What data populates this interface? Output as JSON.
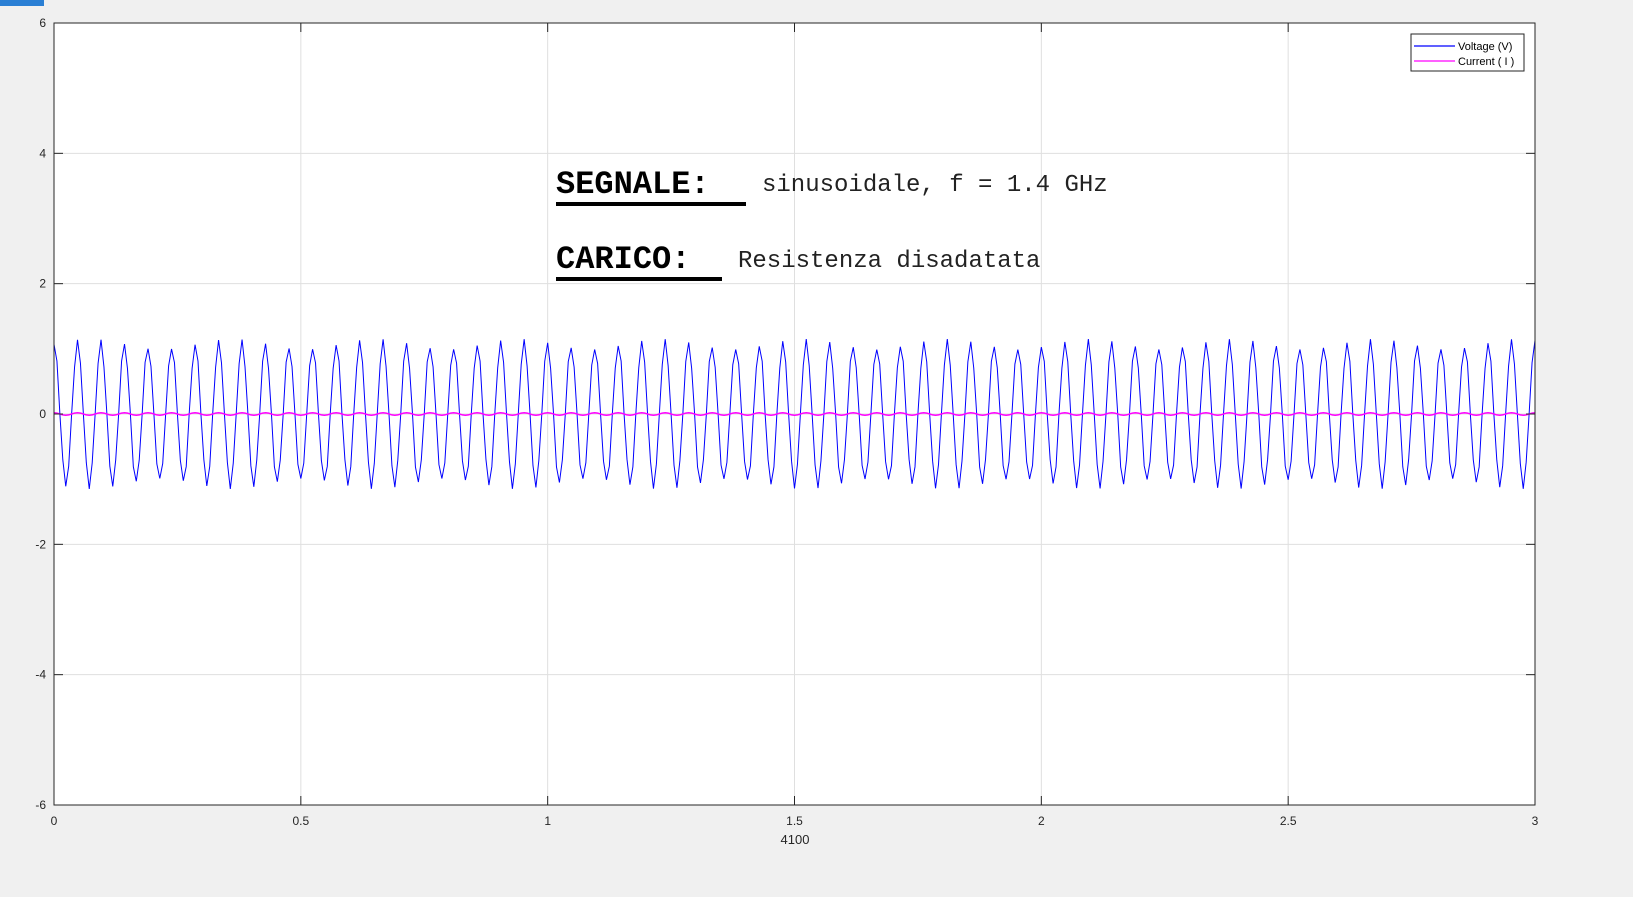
{
  "annotation": {
    "line1_head": "SEGNALE:",
    "line1_body": "sinusoidale, f = 1.4 GHz",
    "line2_head": "CARICO:",
    "line2_body": "Resistenza disadatata"
  },
  "colors": {
    "voltage": "#0000ff",
    "current": "#ff00ff",
    "grid": "#dfdfdf",
    "axes_bg": "#ffffff",
    "window_bg": "#f0f0f0",
    "corner_tab": "#2a7fd4"
  },
  "chart_data": {
    "type": "line",
    "title": "",
    "xlabel": "4100",
    "ylabel": "",
    "xlim": [
      0,
      3
    ],
    "ylim": [
      -6,
      6
    ],
    "xticks": [
      0,
      0.5,
      1,
      1.5,
      2,
      2.5,
      3
    ],
    "xtick_labels": [
      "0",
      "0.5",
      "1",
      "1.5",
      "2",
      "2.5",
      "3"
    ],
    "yticks": [
      -6,
      -4,
      -2,
      0,
      2,
      4,
      6
    ],
    "ytick_labels": [
      "-6",
      "-4",
      "-2",
      "0",
      "2",
      "4",
      "6"
    ],
    "grid": true,
    "legend_location": "top-right",
    "series": [
      {
        "name": "Voltage (V)",
        "color": "#0000ff",
        "waveform": "sinusoid",
        "cycles": 63,
        "amplitude": 1.15,
        "offset": 0.0,
        "peak_max": 1.2,
        "trough_min": -1.25
      },
      {
        "name": "Current ( I )",
        "color": "#ff00ff",
        "waveform": "sinusoid",
        "cycles": 63,
        "amplitude": 0.02,
        "offset": 0.0
      }
    ]
  }
}
